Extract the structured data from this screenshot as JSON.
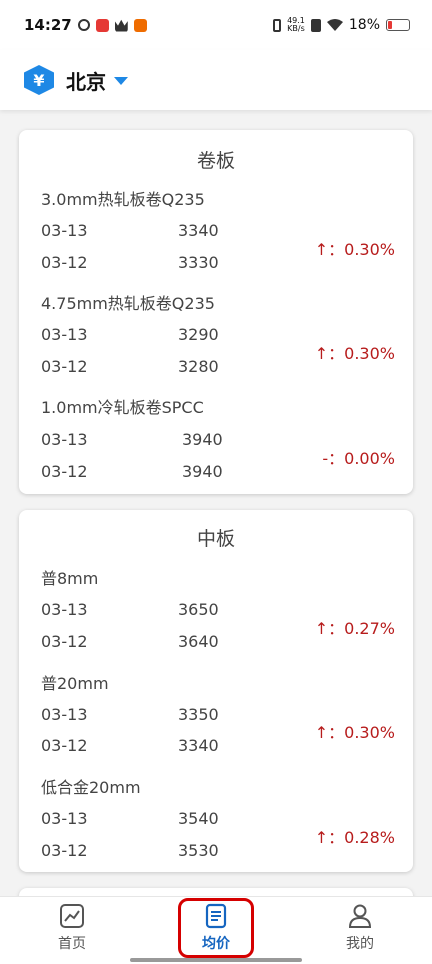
{
  "status_bar": {
    "time": "14:27",
    "net_speed_top": "49.1",
    "net_speed_bottom": "KB/s",
    "battery": "18%"
  },
  "header": {
    "badge_symbol": "¥",
    "city": "北京"
  },
  "cards": [
    {
      "title": "卷板",
      "products": [
        {
          "name": "3.0mm热轧板卷Q235",
          "rows": [
            {
              "date": "03-13",
              "price": "3340"
            },
            {
              "date": "03-12",
              "price": "3330"
            }
          ],
          "change": "↑：0.30%"
        },
        {
          "name": "4.75mm热轧板卷Q235",
          "rows": [
            {
              "date": "03-13",
              "price": "3290"
            },
            {
              "date": "03-12",
              "price": "3280"
            }
          ],
          "change": "↑：0.30%"
        },
        {
          "name": "1.0mm冷轧板卷SPCC",
          "rows": [
            {
              "date": "03-13",
              "price": "3940"
            },
            {
              "date": "03-12",
              "price": "3940"
            }
          ],
          "change": "-：0.00%"
        }
      ]
    },
    {
      "title": "中板",
      "products": [
        {
          "name": "普8mm",
          "rows": [
            {
              "date": "03-13",
              "price": "3650"
            },
            {
              "date": "03-12",
              "price": "3640"
            }
          ],
          "change": "↑：0.27%"
        },
        {
          "name": "普20mm",
          "rows": [
            {
              "date": "03-13",
              "price": "3350"
            },
            {
              "date": "03-12",
              "price": "3340"
            }
          ],
          "change": "↑：0.30%"
        },
        {
          "name": "低合金20mm",
          "rows": [
            {
              "date": "03-13",
              "price": "3540"
            },
            {
              "date": "03-12",
              "price": "3530"
            }
          ],
          "change": "↑：0.28%"
        }
      ]
    }
  ],
  "nav": {
    "home_label": "首页",
    "avg_label": "均价",
    "mine_label": "我的"
  },
  "colors": {
    "accent": "#1565c0",
    "change_red": "#b71c1c",
    "highlight": "#d50000"
  }
}
